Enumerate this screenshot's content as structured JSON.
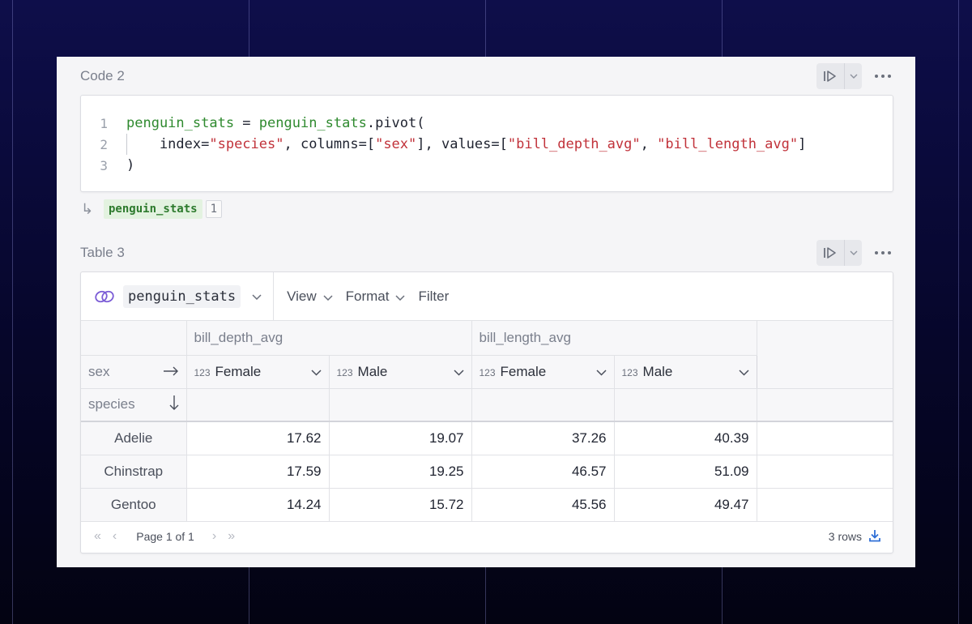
{
  "code_cell": {
    "title": "Code 2",
    "lines": [
      {
        "num": "1",
        "parts": [
          [
            "fn",
            "penguin_stats"
          ],
          [
            "",
            " = "
          ],
          [
            "fn",
            "penguin_stats"
          ],
          [
            "",
            ".pivot("
          ]
        ]
      },
      {
        "num": "2",
        "parts": [
          [
            "",
            "    index="
          ],
          [
            "str",
            "\"species\""
          ],
          [
            "",
            ", columns=["
          ],
          [
            "str",
            "\"sex\""
          ],
          [
            "",
            "], values=["
          ],
          [
            "str",
            "\"bill_depth_avg\""
          ],
          [
            "",
            ", "
          ],
          [
            "str",
            "\"bill_length_avg\""
          ],
          [
            "",
            "]"
          ]
        ]
      },
      {
        "num": "3",
        "parts": [
          [
            "",
            ")"
          ]
        ]
      }
    ],
    "output_var": "penguin_stats",
    "output_count": "1"
  },
  "table_cell": {
    "title": "Table 3",
    "source_name": "penguin_stats",
    "menu": [
      "View",
      "Format",
      "Filter"
    ],
    "group_headers": [
      "bill_depth_avg",
      "bill_length_avg"
    ],
    "col_label": "sex",
    "index_label": "species",
    "type_badge": "123",
    "columns": [
      "Female",
      "Male",
      "Female",
      "Male"
    ],
    "rows": [
      {
        "species": "Adelie",
        "values": [
          "17.62",
          "19.07",
          "37.26",
          "40.39"
        ]
      },
      {
        "species": "Chinstrap",
        "values": [
          "17.59",
          "19.25",
          "46.57",
          "51.09"
        ]
      },
      {
        "species": "Gentoo",
        "values": [
          "14.24",
          "15.72",
          "45.56",
          "49.47"
        ]
      }
    ],
    "pager_text": "Page 1 of 1",
    "rows_text": "3 rows"
  },
  "colors": {
    "fn": "#2f8a2f",
    "str": "#c1323a",
    "accent": "#7b5cd6",
    "download": "#2f6fd6"
  }
}
